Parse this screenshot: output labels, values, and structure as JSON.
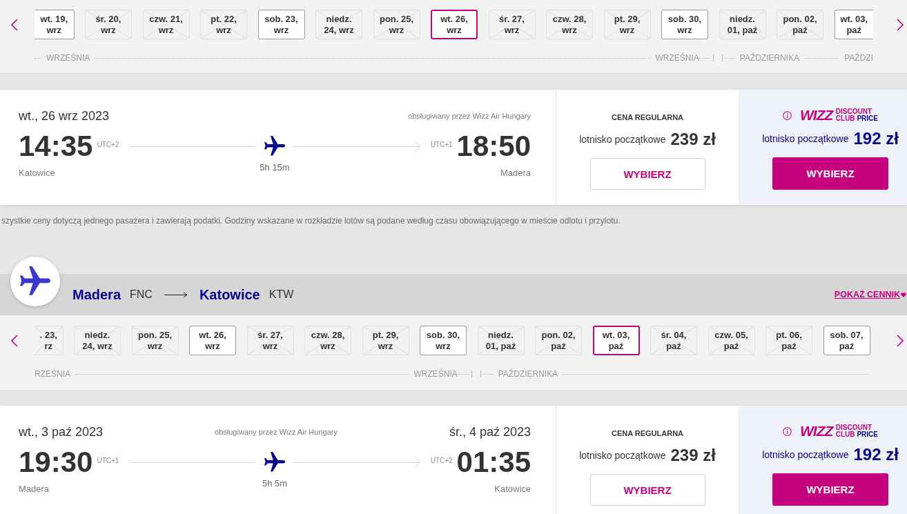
{
  "journeys": [
    {
      "date_strip": {
        "months": [
          {
            "labels": [
              "WRZEŚNIA",
              "WRZEŚNIA"
            ],
            "days": [
              {
                "lines": [
                  "wt. 19,",
                  "wrz"
                ],
                "available": true,
                "selected": false
              },
              {
                "lines": [
                  "śr. 20,",
                  "wrz"
                ],
                "available": false,
                "selected": false
              },
              {
                "lines": [
                  "czw. 21,",
                  "wrz"
                ],
                "available": false,
                "selected": false
              },
              {
                "lines": [
                  "pt. 22,",
                  "wrz"
                ],
                "available": false,
                "selected": false
              },
              {
                "lines": [
                  "sob. 23,",
                  "wrz"
                ],
                "available": true,
                "selected": false
              },
              {
                "lines": [
                  "niedz.",
                  "24, wrz"
                ],
                "available": false,
                "selected": false
              },
              {
                "lines": [
                  "pon. 25,",
                  "wrz"
                ],
                "available": false,
                "selected": false
              },
              {
                "lines": [
                  "wt. 26,",
                  "wrz"
                ],
                "available": true,
                "selected": true
              },
              {
                "lines": [
                  "śr. 27,",
                  "wrz"
                ],
                "available": false,
                "selected": false
              },
              {
                "lines": [
                  "czw. 28,",
                  "wrz"
                ],
                "available": false,
                "selected": false
              },
              {
                "lines": [
                  "pt. 29,",
                  "wrz"
                ],
                "available": false,
                "selected": false
              },
              {
                "lines": [
                  "sob. 30,",
                  "wrz"
                ],
                "available": true,
                "selected": false
              }
            ]
          },
          {
            "labels": [
              "PAŹDZIERNIKA",
              "PAŹDZI"
            ],
            "days": [
              {
                "lines": [
                  "niedz.",
                  "01, paź"
                ],
                "available": false,
                "selected": false
              },
              {
                "lines": [
                  "pon. 02,",
                  "paź"
                ],
                "available": false,
                "selected": false
              },
              {
                "lines": [
                  "wt. 03,",
                  "paź"
                ],
                "available": true,
                "selected": false
              }
            ]
          }
        ]
      },
      "flight": {
        "departure": {
          "date": "wt., 26 wrz 2023",
          "time": "14:35",
          "utc": "UTC+2",
          "city": "Katowice"
        },
        "operator": "obsługiwany przez Wizz Air Hungary",
        "duration": "5h 15m",
        "arrival": {
          "time": "18:50",
          "utc": "UTC+1",
          "city": "Madera"
        },
        "regular_fare": {
          "title": "CENA REGULARNA",
          "label": "lotnisko początkowe",
          "price": "239 zł",
          "button": "WYBIERZ"
        },
        "club_fare": {
          "logo": {
            "brand": "WIZZ",
            "words": [
              "DISCOUNT",
              "CLUB",
              "PRICE"
            ]
          },
          "label": "lotnisko początkowe",
          "price": "192 zł",
          "button": "WYBIERZ"
        }
      },
      "disclaimer": "szystkie ceny dotyczą jednego pasażera i zawierają podatki. Godziny wskazane w rozkładzie lotów są podane według czasu obowiązującego w mieście odlotu i przylotu."
    },
    {
      "route": {
        "from": {
          "city": "Madera",
          "code": "FNC"
        },
        "to": {
          "city": "Katowice",
          "code": "KTW"
        },
        "link": "POKAŻ CENNIK"
      },
      "date_strip": {
        "months": [
          {
            "labels": [
              "RZEŚNIA",
              "WRZEŚNIA"
            ],
            "days": [
              {
                "lines": [
                  ". 23,",
                  "rz"
                ],
                "available": false,
                "selected": false
              },
              {
                "lines": [
                  "niedz.",
                  "24, wrz"
                ],
                "available": false,
                "selected": false
              },
              {
                "lines": [
                  "pon. 25,",
                  "wrz"
                ],
                "available": false,
                "selected": false
              },
              {
                "lines": [
                  "wt. 26,",
                  "wrz"
                ],
                "available": true,
                "selected": false
              },
              {
                "lines": [
                  "śr. 27,",
                  "wrz"
                ],
                "available": false,
                "selected": false
              },
              {
                "lines": [
                  "czw. 28,",
                  "wrz"
                ],
                "available": false,
                "selected": false
              },
              {
                "lines": [
                  "pt. 29,",
                  "wrz"
                ],
                "available": false,
                "selected": false
              },
              {
                "lines": [
                  "sob. 30,",
                  "wrz"
                ],
                "available": true,
                "selected": false
              }
            ]
          },
          {
            "labels": [
              "PAŹDZIERNIKA"
            ],
            "days": [
              {
                "lines": [
                  "niedz.",
                  "01, paź"
                ],
                "available": false,
                "selected": false
              },
              {
                "lines": [
                  "pon. 02,",
                  "paź"
                ],
                "available": false,
                "selected": false
              },
              {
                "lines": [
                  "wt. 03,",
                  "paź"
                ],
                "available": true,
                "selected": true
              },
              {
                "lines": [
                  "śr. 04,",
                  "paź"
                ],
                "available": false,
                "selected": false
              },
              {
                "lines": [
                  "czw. 05,",
                  "paź"
                ],
                "available": false,
                "selected": false
              },
              {
                "lines": [
                  "pt. 06,",
                  "paź"
                ],
                "available": false,
                "selected": false
              },
              {
                "lines": [
                  "sob. 07,",
                  "paź"
                ],
                "available": true,
                "selected": false
              }
            ]
          }
        ]
      },
      "flight": {
        "departure": {
          "date": "wt., 3 paź 2023",
          "time": "19:30",
          "utc": "UTC+1",
          "city": "Madera"
        },
        "operator": "obsługiwany przez Wizz Air Hungary",
        "duration": "5h 5m",
        "arrival": {
          "date": "śr., 4 paź 2023",
          "time": "01:35",
          "utc": "UTC+2",
          "city": "Katowice"
        },
        "regular_fare": {
          "title": "CENA REGULARNA",
          "label": "lotnisko początkowe",
          "price": "239 zł",
          "button": "WYBIERZ"
        },
        "club_fare": {
          "logo": {
            "brand": "WIZZ",
            "words": [
              "DISCOUNT",
              "CLUB",
              "PRICE"
            ]
          },
          "label": "lotnisko początkowe",
          "price": "192 zł",
          "button": "WYBIERZ"
        }
      }
    }
  ]
}
